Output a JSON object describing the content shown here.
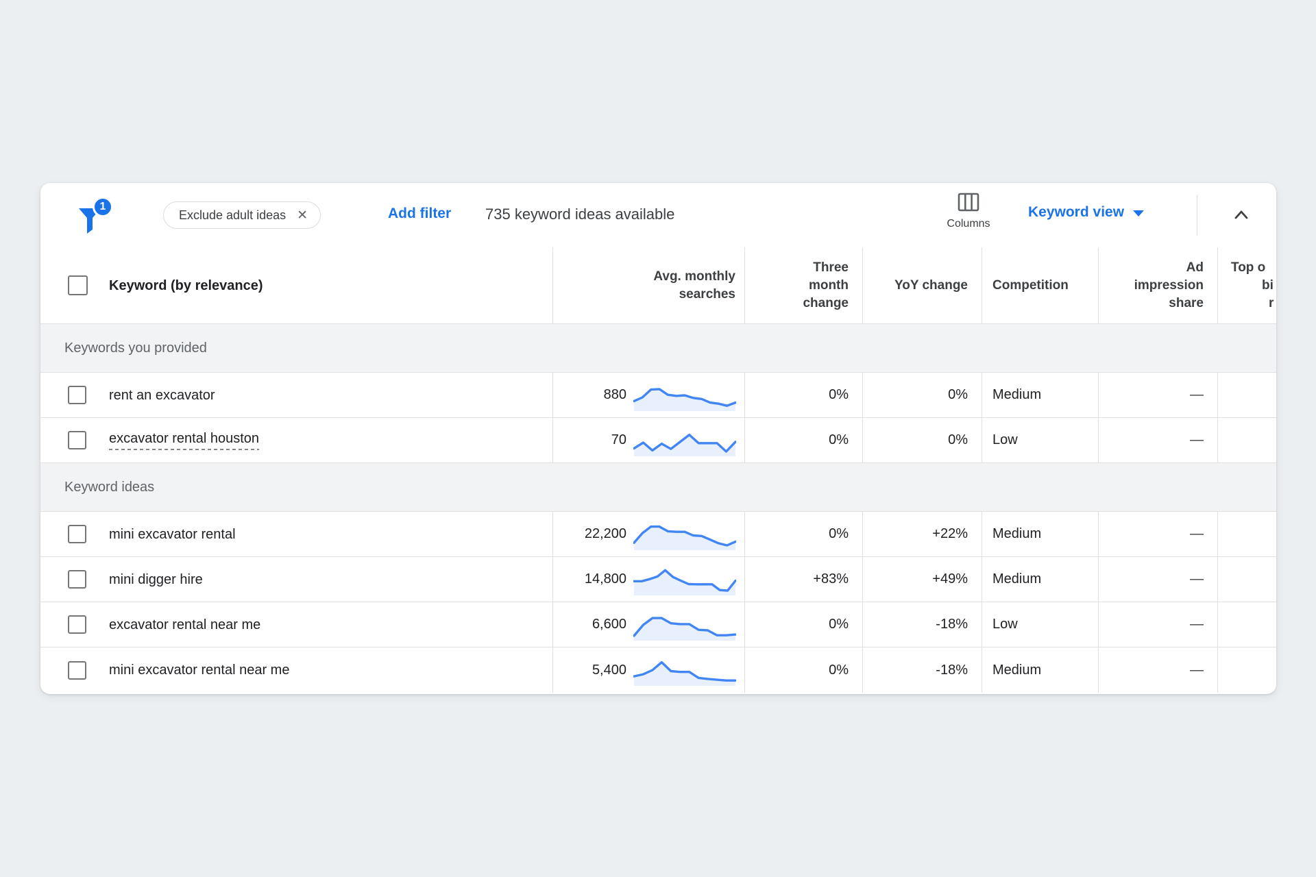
{
  "toolbar": {
    "filter_badge": "1",
    "filter_chip": "Exclude adult ideas",
    "add_filter": "Add filter",
    "summary": "735 keyword ideas available",
    "columns": "Columns",
    "view_selector": "Keyword view"
  },
  "table": {
    "headers": {
      "keyword": "Keyword (by relevance)",
      "avg_monthly_searches": "Avg. monthly searches",
      "three_month_change": "Three month change",
      "yoy_change": "YoY change",
      "competition": "Competition",
      "ad_impression_share": "Ad impression share",
      "top_of_page_bid_clipped_lines": [
        "Top o",
        "bi",
        "r"
      ]
    },
    "sections": [
      {
        "label": "Keywords you provided",
        "rows": [
          {
            "keyword": "rent an excavator",
            "underlined": false,
            "avg_monthly_searches": "880",
            "trend": [
              0.28,
              0.42,
              0.72,
              0.74,
              0.52,
              0.48,
              0.5,
              0.4,
              0.36,
              0.22,
              0.18,
              0.1,
              0.22
            ],
            "three_month_change": "0%",
            "yoy_change": "0%",
            "competition": "Medium",
            "ad_impression_share": "—"
          },
          {
            "keyword": "excavator rental houston",
            "underlined": true,
            "avg_monthly_searches": "70",
            "trend": [
              0.2,
              0.42,
              0.12,
              0.38,
              0.18,
              0.45,
              0.72,
              0.4,
              0.4,
              0.4,
              0.08,
              0.45
            ],
            "three_month_change": "0%",
            "yoy_change": "0%",
            "competition": "Low",
            "ad_impression_share": "—"
          }
        ]
      },
      {
        "label": "Keyword ideas",
        "rows": [
          {
            "keyword": "mini excavator rental",
            "underlined": false,
            "avg_monthly_searches": "22,200",
            "trend": [
              0.18,
              0.55,
              0.8,
              0.8,
              0.62,
              0.6,
              0.6,
              0.46,
              0.44,
              0.3,
              0.16,
              0.08,
              0.22
            ],
            "three_month_change": "0%",
            "yoy_change": "+22%",
            "competition": "Medium",
            "ad_impression_share": "—"
          },
          {
            "keyword": "mini digger hire",
            "underlined": false,
            "avg_monthly_searches": "14,800",
            "trend": [
              0.44,
              0.44,
              0.52,
              0.62,
              0.86,
              0.6,
              0.46,
              0.33,
              0.32,
              0.32,
              0.32,
              0.1,
              0.08,
              0.46
            ],
            "three_month_change": "+83%",
            "yoy_change": "+49%",
            "competition": "Medium",
            "ad_impression_share": "—"
          },
          {
            "keyword": "excavator rental near me",
            "underlined": false,
            "avg_monthly_searches": "6,600",
            "trend": [
              0.08,
              0.5,
              0.76,
              0.76,
              0.56,
              0.53,
              0.53,
              0.31,
              0.29,
              0.1,
              0.1,
              0.13
            ],
            "three_month_change": "0%",
            "yoy_change": "-18%",
            "competition": "Low",
            "ad_impression_share": "—"
          },
          {
            "keyword": "mini excavator rental near me",
            "underlined": false,
            "avg_monthly_searches": "5,400",
            "trend": [
              0.26,
              0.34,
              0.5,
              0.8,
              0.46,
              0.43,
              0.43,
              0.2,
              0.16,
              0.13,
              0.1,
              0.1
            ],
            "three_month_change": "0%",
            "yoy_change": "-18%",
            "competition": "Medium",
            "ad_impression_share": "—"
          }
        ]
      }
    ]
  },
  "colors": {
    "accent_blue": "#1a73e8",
    "spark_line": "#4285f4",
    "spark_fill": "#e8f0fe",
    "text_primary": "#202124",
    "text_secondary": "#5f6368",
    "section_bg": "#f1f3f4",
    "border": "#e0e0e0",
    "page_bg": "#ebeff2"
  }
}
